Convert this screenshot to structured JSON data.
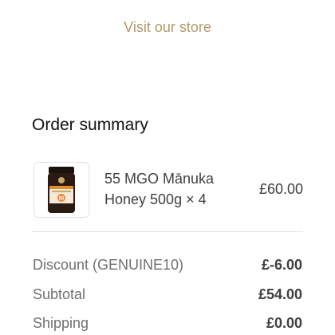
{
  "header": {
    "store_link": "Visit our store"
  },
  "summary": {
    "title": "Order summary",
    "items": [
      {
        "name": "55 MGO Mānuka Honey 500g × 4",
        "price": "£60.00",
        "image_icon": "honey-jar-icon",
        "image_label": "55",
        "jar_color": "#2a1a12",
        "label_color": "#e9892f"
      }
    ],
    "rows": [
      {
        "label": "Discount (GENUINE10)",
        "value": "£-6.00"
      },
      {
        "label": "Subtotal",
        "value": "£54.00"
      },
      {
        "label": "Shipping",
        "value": "£0.00"
      }
    ]
  },
  "colors": {
    "accent": "#b09a6a",
    "title": "#111111",
    "muted": "#707070",
    "value": "#404040",
    "divider": "#e3e3e3"
  }
}
